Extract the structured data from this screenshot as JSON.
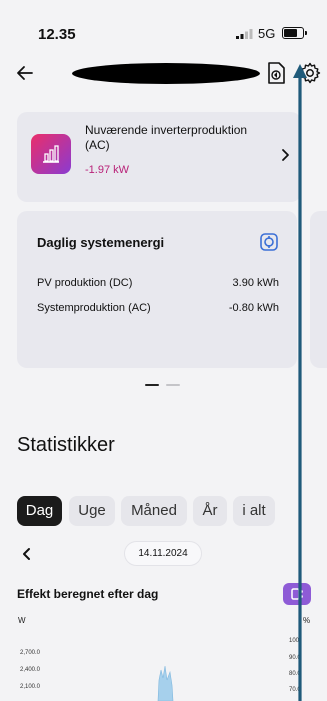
{
  "status_bar": {
    "time": "12.35",
    "network": "5G",
    "battery_level": 0.75
  },
  "nav": {
    "back_icon": "arrow-left-icon",
    "title": "",
    "doc_icon": "document-icon",
    "settings_icon": "gear-icon"
  },
  "inverter_card": {
    "title": "Nuværende inverterproduktion (AC)",
    "value": "-1.97 kW",
    "value_color": "#b82178",
    "icon": "bar-chart-icon"
  },
  "energy_card": {
    "title": "Daglig systemenergi",
    "rows": [
      {
        "label": "PV produktion (DC)",
        "value": "3.90 kWh"
      },
      {
        "label": "Systemproduktion (AC)",
        "value": "-0.80 kWh"
      }
    ]
  },
  "statistics": {
    "title": "Statistikker",
    "tabs": [
      {
        "label": "Dag",
        "active": true
      },
      {
        "label": "Uge",
        "active": false
      },
      {
        "label": "Måned",
        "active": false
      },
      {
        "label": "År",
        "active": false
      },
      {
        "label": "i alt",
        "active": false
      }
    ],
    "date": "14.11.2024"
  },
  "chart_data": {
    "type": "area",
    "title": "Effekt beregnet efter dag",
    "ylabel_left": "W",
    "ylabel_right": "%",
    "y_left_ticks": [
      "2,700.0",
      "2,400.0",
      "2,100.0"
    ],
    "y_right_ticks": [
      "100",
      "90.0",
      "80.0",
      "70.0"
    ],
    "series_color": "#a6d0ec"
  },
  "colors": {
    "accent": "#8e5bd6",
    "overlay_arrow": "#1f5a7a"
  }
}
